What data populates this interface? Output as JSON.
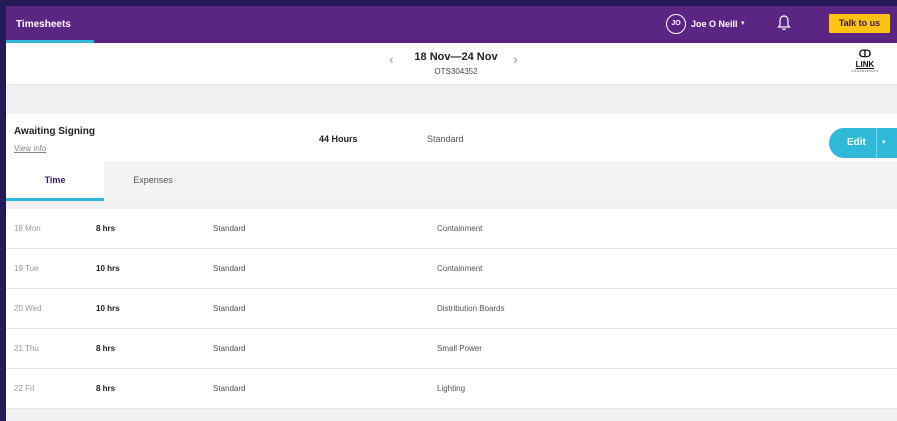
{
  "nav": {
    "tab_label": "Timesheets",
    "user_initials": "JO",
    "user_name": "Joe O Neill",
    "user_caret": "▾",
    "talk_label": "Talk to us"
  },
  "week": {
    "range": "18 Nov—24 Nov",
    "reference": "OTS304352",
    "prev": "‹",
    "next": "›"
  },
  "logo": {
    "mark": "ↀ",
    "text": "LINK",
    "sub": "CONSULTANTS"
  },
  "summary": {
    "status": "Awaiting Signing",
    "view_info": "View info",
    "total_hours": "44 Hours",
    "rate_type": "Standard",
    "edit_label": "Edit",
    "edit_caret": "▾"
  },
  "tabs": {
    "time": "Time",
    "expenses": "Expenses"
  },
  "entries": [
    {
      "day": "18 Mon",
      "hours": "8 hrs",
      "type": "Standard",
      "task": "Containment"
    },
    {
      "day": "19 Tue",
      "hours": "10 hrs",
      "type": "Standard",
      "task": "Containment"
    },
    {
      "day": "20 Wed",
      "hours": "10 hrs",
      "type": "Standard",
      "task": "Distribution Boards"
    },
    {
      "day": "21 Thu",
      "hours": "8 hrs",
      "type": "Standard",
      "task": "Small Power"
    },
    {
      "day": "22 Fri",
      "hours": "8 hrs",
      "type": "Standard",
      "task": "Lighting"
    }
  ],
  "colors": {
    "brand_purple": "#5b2583",
    "accent_cyan": "#2fb8d8",
    "cta_yellow": "#ffc20e"
  },
  "icons": {
    "bell": "bell-icon",
    "avatar": "user-avatar-icon",
    "logo": "link-logo-icon"
  }
}
